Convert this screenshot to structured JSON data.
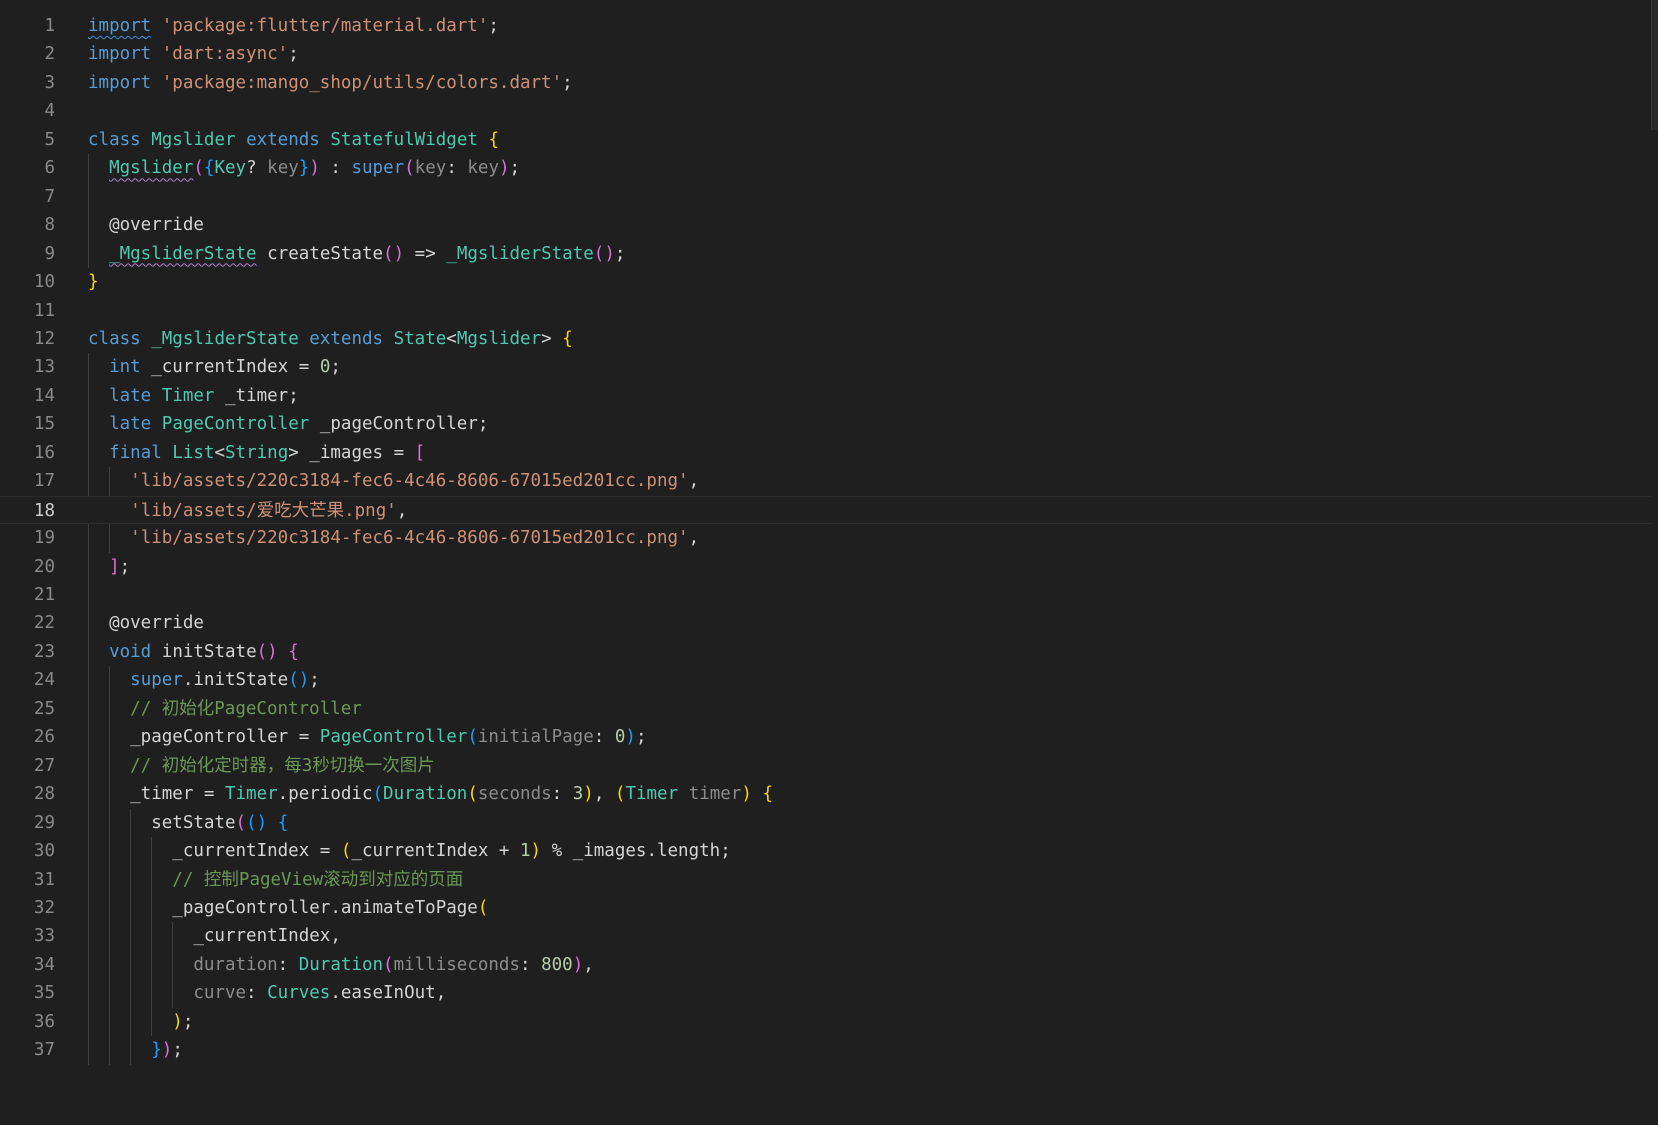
{
  "editor": {
    "language": "dart",
    "current_line": 18,
    "lines": [
      {
        "n": "1",
        "tokens": [
          [
            "kw sq",
            "import"
          ],
          [
            "pl",
            " "
          ],
          [
            "str",
            "'package:flutter/material.dart'"
          ],
          [
            "pl",
            ";"
          ]
        ]
      },
      {
        "n": "2",
        "tokens": [
          [
            "kw",
            "import"
          ],
          [
            "pl",
            " "
          ],
          [
            "str",
            "'dart:async'"
          ],
          [
            "pl",
            ";"
          ]
        ]
      },
      {
        "n": "3",
        "tokens": [
          [
            "kw",
            "import"
          ],
          [
            "pl",
            " "
          ],
          [
            "str",
            "'package:mango_shop/utils/colors.dart'"
          ],
          [
            "pl",
            ";"
          ]
        ]
      },
      {
        "n": "4",
        "tokens": []
      },
      {
        "n": "5",
        "tokens": [
          [
            "kw",
            "class"
          ],
          [
            "pl",
            " "
          ],
          [
            "typ",
            "Mgslider"
          ],
          [
            "pl",
            " "
          ],
          [
            "kw",
            "extends"
          ],
          [
            "pl",
            " "
          ],
          [
            "typ",
            "StatefulWidget"
          ],
          [
            "pl",
            " "
          ],
          [
            "b1",
            "{"
          ]
        ]
      },
      {
        "n": "6",
        "tokens": [
          [
            "pl",
            "  "
          ],
          [
            "typ sqr",
            "Mgslider"
          ],
          [
            "b2",
            "("
          ],
          [
            "b3",
            "{"
          ],
          [
            "typ",
            "Key"
          ],
          [
            "pl",
            "? "
          ],
          [
            "prm",
            "key"
          ],
          [
            "b3",
            "}"
          ],
          [
            "b2",
            ")"
          ],
          [
            "pl",
            " : "
          ],
          [
            "kw",
            "super"
          ],
          [
            "b2",
            "("
          ],
          [
            "prm",
            "key"
          ],
          [
            "pl",
            ": "
          ],
          [
            "prm",
            "key"
          ],
          [
            "b2",
            ")"
          ],
          [
            "pl",
            ";"
          ]
        ]
      },
      {
        "n": "7",
        "tokens": []
      },
      {
        "n": "8",
        "tokens": [
          [
            "pl",
            "  "
          ],
          [
            "ann",
            "@override"
          ]
        ]
      },
      {
        "n": "9",
        "tokens": [
          [
            "pl",
            "  "
          ],
          [
            "typ sqr",
            "_MgsliderState"
          ],
          [
            "pl",
            " "
          ],
          [
            "fnw",
            "createState"
          ],
          [
            "b2",
            "()"
          ],
          [
            "pl",
            " => "
          ],
          [
            "typ",
            "_MgsliderState"
          ],
          [
            "b2",
            "()"
          ],
          [
            "pl",
            ";"
          ]
        ]
      },
      {
        "n": "10",
        "tokens": [
          [
            "b1",
            "}"
          ]
        ]
      },
      {
        "n": "11",
        "tokens": []
      },
      {
        "n": "12",
        "tokens": [
          [
            "kw",
            "class"
          ],
          [
            "pl",
            " "
          ],
          [
            "typ",
            "_MgsliderState"
          ],
          [
            "pl",
            " "
          ],
          [
            "kw",
            "extends"
          ],
          [
            "pl",
            " "
          ],
          [
            "typ",
            "State"
          ],
          [
            "pl",
            "<"
          ],
          [
            "typ",
            "Mgslider"
          ],
          [
            "pl",
            "> "
          ],
          [
            "b1",
            "{"
          ]
        ]
      },
      {
        "n": "13",
        "tokens": [
          [
            "pl",
            "  "
          ],
          [
            "kw",
            "int"
          ],
          [
            "pl",
            " _currentIndex = "
          ],
          [
            "num",
            "0"
          ],
          [
            "pl",
            ";"
          ]
        ]
      },
      {
        "n": "14",
        "tokens": [
          [
            "pl",
            "  "
          ],
          [
            "kw",
            "late"
          ],
          [
            "pl",
            " "
          ],
          [
            "typ",
            "Timer"
          ],
          [
            "pl",
            " _timer;"
          ]
        ]
      },
      {
        "n": "15",
        "tokens": [
          [
            "pl",
            "  "
          ],
          [
            "kw",
            "late"
          ],
          [
            "pl",
            " "
          ],
          [
            "typ",
            "PageController"
          ],
          [
            "pl",
            " _pageController;"
          ]
        ]
      },
      {
        "n": "16",
        "tokens": [
          [
            "pl",
            "  "
          ],
          [
            "kw",
            "final"
          ],
          [
            "pl",
            " "
          ],
          [
            "typ",
            "List"
          ],
          [
            "pl",
            "<"
          ],
          [
            "typ",
            "String"
          ],
          [
            "pl",
            "> _images = "
          ],
          [
            "b2",
            "["
          ]
        ]
      },
      {
        "n": "17",
        "tokens": [
          [
            "pl",
            "    "
          ],
          [
            "str",
            "'lib/assets/220c3184-fec6-4c46-8606-67015ed201cc.png'"
          ],
          [
            "pl",
            ","
          ]
        ]
      },
      {
        "n": "18",
        "tokens": [
          [
            "pl",
            "    "
          ],
          [
            "str",
            "'lib/assets/爱吃大芒果.png'"
          ],
          [
            "pl",
            ","
          ]
        ]
      },
      {
        "n": "19",
        "tokens": [
          [
            "pl",
            "    "
          ],
          [
            "str",
            "'lib/assets/220c3184-fec6-4c46-8606-67015ed201cc.png'"
          ],
          [
            "pl",
            ","
          ]
        ]
      },
      {
        "n": "20",
        "tokens": [
          [
            "pl",
            "  "
          ],
          [
            "b2",
            "]"
          ],
          [
            "pl",
            ";"
          ]
        ]
      },
      {
        "n": "21",
        "tokens": []
      },
      {
        "n": "22",
        "tokens": [
          [
            "pl",
            "  "
          ],
          [
            "ann",
            "@override"
          ]
        ]
      },
      {
        "n": "23",
        "tokens": [
          [
            "pl",
            "  "
          ],
          [
            "kw",
            "void"
          ],
          [
            "pl",
            " "
          ],
          [
            "fnw",
            "initState"
          ],
          [
            "b2",
            "()"
          ],
          [
            "pl",
            " "
          ],
          [
            "b2",
            "{"
          ]
        ]
      },
      {
        "n": "24",
        "tokens": [
          [
            "pl",
            "    "
          ],
          [
            "kw",
            "super"
          ],
          [
            "pl",
            "."
          ],
          [
            "fnw",
            "initState"
          ],
          [
            "b3",
            "()"
          ],
          [
            "pl",
            ";"
          ]
        ]
      },
      {
        "n": "25",
        "tokens": [
          [
            "pl",
            "    "
          ],
          [
            "cmt",
            "// 初始化PageController"
          ]
        ]
      },
      {
        "n": "26",
        "tokens": [
          [
            "pl",
            "    _pageController = "
          ],
          [
            "typ",
            "PageController"
          ],
          [
            "b3",
            "("
          ],
          [
            "prm",
            "initialPage"
          ],
          [
            "pl",
            ": "
          ],
          [
            "num",
            "0"
          ],
          [
            "b3",
            ")"
          ],
          [
            "pl",
            ";"
          ]
        ]
      },
      {
        "n": "27",
        "tokens": [
          [
            "pl",
            "    "
          ],
          [
            "cmt",
            "// 初始化定时器，每3秒切换一次图片"
          ]
        ]
      },
      {
        "n": "28",
        "tokens": [
          [
            "pl",
            "    _timer = "
          ],
          [
            "typ",
            "Timer"
          ],
          [
            "pl",
            "."
          ],
          [
            "fnw",
            "periodic"
          ],
          [
            "b3",
            "("
          ],
          [
            "typ",
            "Duration"
          ],
          [
            "b1",
            "("
          ],
          [
            "prm",
            "seconds"
          ],
          [
            "pl",
            ": "
          ],
          [
            "num",
            "3"
          ],
          [
            "b1",
            ")"
          ],
          [
            "pl",
            ", "
          ],
          [
            "b1",
            "("
          ],
          [
            "typ",
            "Timer"
          ],
          [
            "pl",
            " "
          ],
          [
            "prm",
            "timer"
          ],
          [
            "b1",
            ")"
          ],
          [
            "pl",
            " "
          ],
          [
            "b1",
            "{"
          ]
        ]
      },
      {
        "n": "29",
        "tokens": [
          [
            "pl",
            "      "
          ],
          [
            "fnw",
            "setState"
          ],
          [
            "b2",
            "("
          ],
          [
            "b3",
            "()"
          ],
          [
            "pl",
            " "
          ],
          [
            "b3",
            "{"
          ]
        ]
      },
      {
        "n": "30",
        "tokens": [
          [
            "pl",
            "        _currentIndex = "
          ],
          [
            "b1",
            "("
          ],
          [
            "pl",
            "_currentIndex + "
          ],
          [
            "num",
            "1"
          ],
          [
            "b1",
            ")"
          ],
          [
            "pl",
            " % _images.length;"
          ]
        ]
      },
      {
        "n": "31",
        "tokens": [
          [
            "pl",
            "        "
          ],
          [
            "cmt",
            "// 控制PageView滚动到对应的页面"
          ]
        ]
      },
      {
        "n": "32",
        "tokens": [
          [
            "pl",
            "        _pageController."
          ],
          [
            "fnw",
            "animateToPage"
          ],
          [
            "b1",
            "("
          ]
        ]
      },
      {
        "n": "33",
        "tokens": [
          [
            "pl",
            "          _currentIndex,"
          ]
        ]
      },
      {
        "n": "34",
        "tokens": [
          [
            "pl",
            "          "
          ],
          [
            "prm",
            "duration"
          ],
          [
            "pl",
            ": "
          ],
          [
            "typ",
            "Duration"
          ],
          [
            "b2",
            "("
          ],
          [
            "prm",
            "milliseconds"
          ],
          [
            "pl",
            ": "
          ],
          [
            "num",
            "800"
          ],
          [
            "b2",
            ")"
          ],
          [
            "pl",
            ","
          ]
        ]
      },
      {
        "n": "35",
        "tokens": [
          [
            "pl",
            "          "
          ],
          [
            "prm",
            "curve"
          ],
          [
            "pl",
            ": "
          ],
          [
            "typ",
            "Curves"
          ],
          [
            "pl",
            ".easeInOut,"
          ]
        ]
      },
      {
        "n": "36",
        "tokens": [
          [
            "pl",
            "        "
          ],
          [
            "b1",
            ")"
          ],
          [
            "pl",
            ";"
          ]
        ]
      },
      {
        "n": "37",
        "tokens": [
          [
            "pl",
            "      "
          ],
          [
            "b3",
            "}"
          ],
          [
            "b2",
            ")"
          ],
          [
            "pl",
            ";"
          ]
        ]
      }
    ]
  }
}
